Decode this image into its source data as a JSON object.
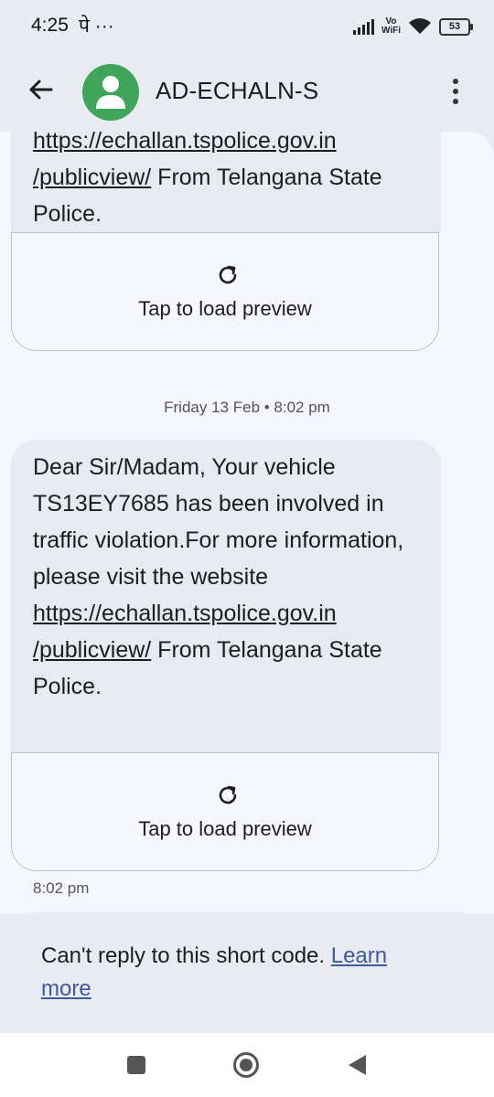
{
  "status_bar": {
    "time": "4:25",
    "extra": "पे ···",
    "network_label_top": "Vo",
    "network_label_bottom": "WiFi",
    "battery": "53"
  },
  "app_bar": {
    "contact_name": "AD-ECHALN-S",
    "avatar_color": "#3fa55a"
  },
  "messages": [
    {
      "text_before_link": "",
      "link_partial": "https://echallan.tspolice.gov.in",
      "link_line2": "/publicview/",
      "text_after_link": " From Telangana State Police.",
      "preview_label": "Tap to load preview"
    },
    {
      "date_separator": "Friday 13 Feb • 8:02 pm",
      "text_before_link": "Dear Sir/Madam, Your vehicle TS13EY7685 has been involved in traffic violation.For more information, please visit the website",
      "link_line1": "https://echallan.tspolice.gov.in",
      "link_line2": "/publicview/",
      "text_after_link": " From Telangana State Police.",
      "preview_label": "Tap to load preview",
      "time": "8:02 pm"
    }
  ],
  "reply_notice": {
    "text": "Can't reply to this short code. ",
    "learn_more": "Learn more"
  },
  "colors": {
    "background": "#e9ebf3",
    "message_area": "#f6f7fc",
    "bubble": "#e8eaf2",
    "link_accent": "#415a9c"
  }
}
